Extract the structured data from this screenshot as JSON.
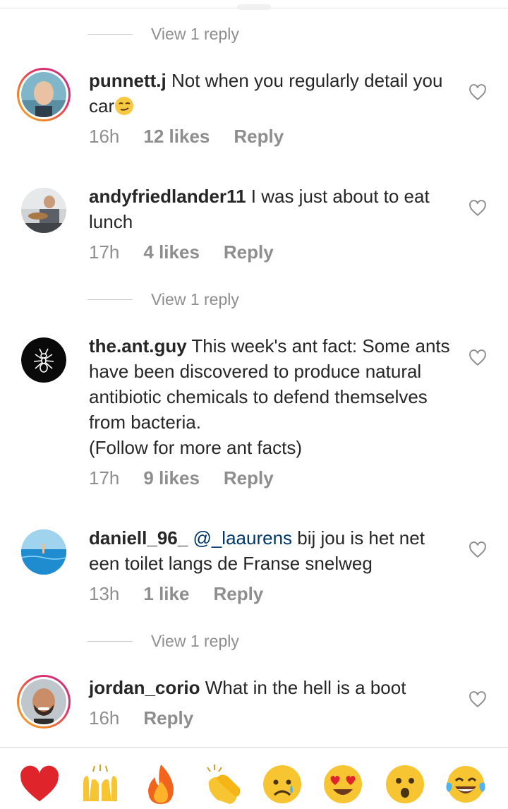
{
  "view_replies": [
    "View 1 reply",
    "View 1 reply",
    "View 1 reply"
  ],
  "comments": [
    {
      "username": "punnett.j",
      "text": " Not when you regularly detail you car",
      "emoji": "smirk",
      "time": "16h",
      "likes": "12 likes",
      "reply": "Reply"
    },
    {
      "username": "andyfriedlander11",
      "text": " I was just about to eat lunch",
      "time": "17h",
      "likes": "4 likes",
      "reply": "Reply"
    },
    {
      "username": "the.ant.guy",
      "text": " This week's ant fact: Some ants have been discovered to produce natural antibiotic chemicals to defend themselves from bacteria.",
      "text2": "(Follow for more ant facts)",
      "time": "17h",
      "likes": "9 likes",
      "reply": "Reply"
    },
    {
      "username": "daniell_96_",
      "mention": "@_laaurens",
      "text": "  bij jou is het net een toilet langs de Franse snelweg",
      "time": "13h",
      "likes": "1 like",
      "reply": "Reply"
    },
    {
      "username": "jordan_corio",
      "text": " What in the hell is a boot",
      "time": "16h",
      "reply": "Reply"
    }
  ],
  "quick_reactions": [
    "red-heart",
    "raising-hands",
    "fire",
    "clapping-hands",
    "sad-face",
    "heart-eyes",
    "surprised-face",
    "tears-of-joy"
  ],
  "colors": {
    "text": "#262626",
    "secondary": "#8e8e8e",
    "mention": "#00376b",
    "story_ring": "#e1306c"
  }
}
